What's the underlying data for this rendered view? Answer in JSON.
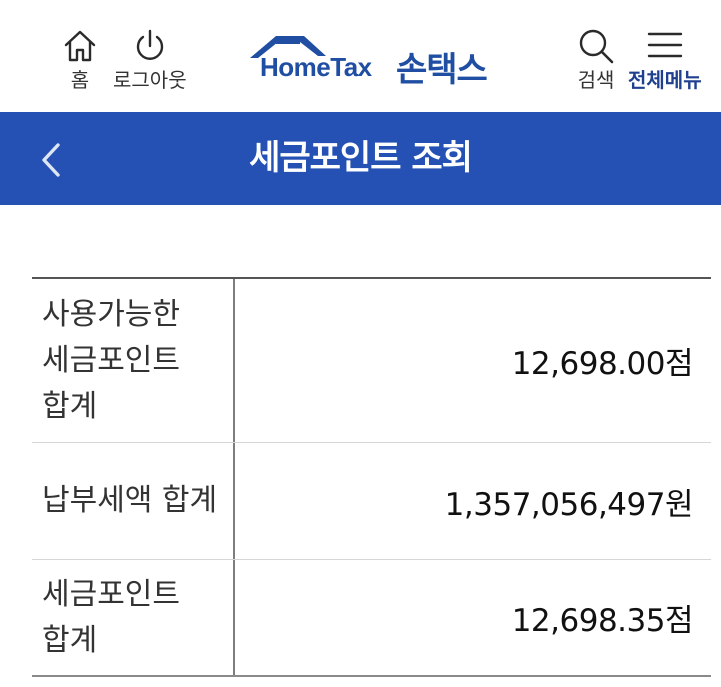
{
  "header": {
    "home_label": "홈",
    "logout_label": "로그아웃",
    "search_label": "검색",
    "menu_label": "전체메뉴",
    "logo_en": "HomeTax",
    "logo_ko": "손택스",
    "icons": {
      "home": "home-icon",
      "logout": "power-icon",
      "search": "search-icon",
      "menu": "hamburger-menu-icon"
    }
  },
  "title_bar": {
    "title": "세금포인트 조회",
    "back_icon": "chevron-left-icon"
  },
  "summary": {
    "rows": [
      {
        "label": "사용가능한 세금포인트 합계",
        "value": "12,698.00점"
      },
      {
        "label": "납부세액 합계",
        "value": "1,357,056,497원"
      },
      {
        "label": "세금포인트 합계",
        "value": "12,698.35점"
      }
    ]
  },
  "colors": {
    "brand_blue": "#2451b3",
    "logo_blue": "#1f4ea3",
    "header_bg": "#ffffff"
  }
}
